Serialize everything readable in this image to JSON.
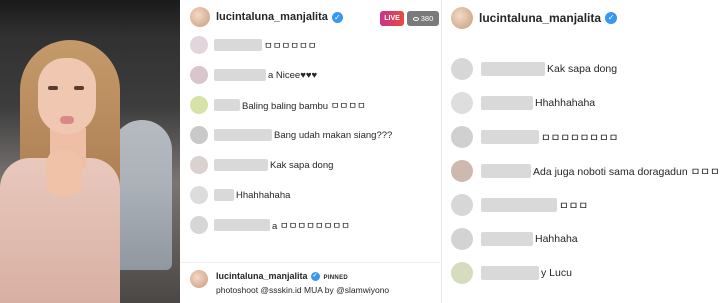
{
  "stream": {
    "username": "lucintaluna_manjalita",
    "live_label": "LIVE",
    "viewer_count": "380"
  },
  "mid_comments": [
    {
      "text": "ㅁㅁㅁㅁㅁㅁ",
      "name_w": 48,
      "avatar": "#e2d6dc"
    },
    {
      "text": "a Nicee♥♥♥",
      "name_w": 52,
      "avatar": "#d8c6cc"
    },
    {
      "text": "Baling baling bambu ㅁㅁㅁㅁ",
      "name_w": 26,
      "avatar": "#d7e2a8"
    },
    {
      "text": "Bang udah makan siang???",
      "name_w": 58,
      "avatar": "#c9c9c9"
    },
    {
      "text": "Kak sapa dong",
      "name_w": 54,
      "avatar": "#d9d2cf"
    },
    {
      "text": "Hhahhahaha",
      "name_w": 20,
      "avatar": "#dcdcdc"
    },
    {
      "text": "a ㅁㅁㅁㅁㅁㅁㅁㅁ",
      "name_w": 56,
      "avatar": "#d6d6d6"
    }
  ],
  "pinned": {
    "username": "lucintaluna_manjalita",
    "badge": "PINNED",
    "text": "photoshoot @ssskin.id MUA by @slamwiyono"
  },
  "right_panel": {
    "username": "lucintaluna_manjalita"
  },
  "right_comments": [
    {
      "text": "Kak sapa dong",
      "name_w": 64,
      "avatar": "#d7d7d7"
    },
    {
      "text": "Hhahhahaha",
      "name_w": 52,
      "avatar": "#dedede"
    },
    {
      "text": "ㅁㅁㅁㅁㅁㅁㅁㅁ",
      "name_w": 58,
      "avatar": "#d0d0d0"
    },
    {
      "text": "Ada juga noboti sama doragadun ㅁㅁㅁ",
      "name_w": 50,
      "avatar": "#cdb9b0"
    },
    {
      "text": "ㅁㅁㅁ",
      "name_w": 76,
      "avatar": "#d7d7d7"
    },
    {
      "text": "Hahhaha",
      "name_w": 52,
      "avatar": "#d3d3d3"
    },
    {
      "text": "y Lucu",
      "name_w": 58,
      "avatar": "#d5dcc0"
    }
  ]
}
